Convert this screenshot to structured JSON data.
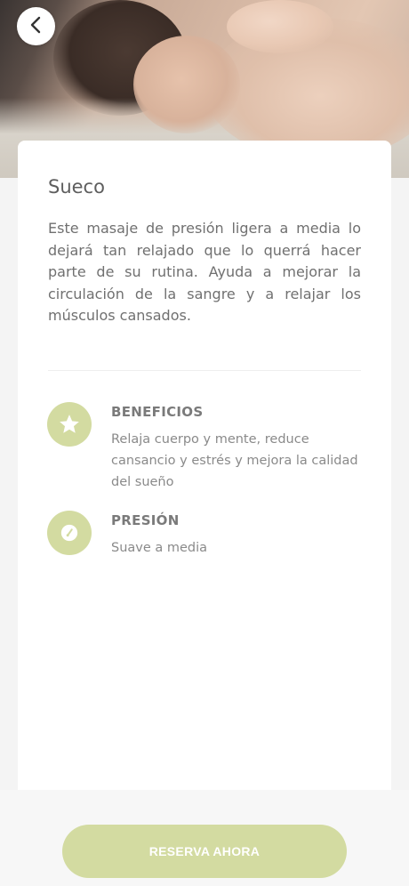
{
  "hero": {
    "image_alt": "massage photo",
    "back_icon": "chevron-left-icon"
  },
  "service": {
    "title": "Sueco",
    "description": "Este masaje de presión ligera a media lo dejará tan relajado que lo querrá hacer parte de su rutina. Ayuda a mejorar la circulación de la sangre y a relajar los músculos cansados."
  },
  "features": [
    {
      "icon": "star-icon",
      "heading": "BENEFICIOS",
      "text": "Relaja cuerpo y mente, reduce cansancio y estrés y mejora la calidad del sueño"
    },
    {
      "icon": "gauge-icon",
      "heading": "PRESIÓN",
      "text": "Suave a media"
    }
  ],
  "cta": {
    "label": "RESERVA AHORA"
  },
  "colors": {
    "accent": "#d3dba1",
    "text": "#707070",
    "card": "#ffffff"
  }
}
